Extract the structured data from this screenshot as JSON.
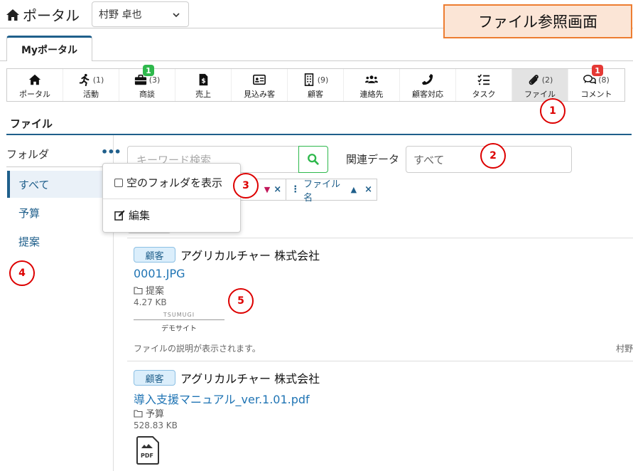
{
  "header": {
    "app_title": "ポータル",
    "user_name": "村野 卓也",
    "screen_title": "ファイル参照画面"
  },
  "tab": {
    "label": "Myポータル"
  },
  "nav": [
    {
      "label": "ポータル",
      "icon": "home-icon",
      "count": ""
    },
    {
      "label": "活動",
      "icon": "running-icon",
      "count": "(1)"
    },
    {
      "label": "商談",
      "icon": "briefcase-icon",
      "count": "(3)",
      "badge": "1"
    },
    {
      "label": "売上",
      "icon": "invoice-icon",
      "count": ""
    },
    {
      "label": "見込み客",
      "icon": "id-card-icon",
      "count": ""
    },
    {
      "label": "顧客",
      "icon": "building-icon",
      "count": "(9)"
    },
    {
      "label": "連絡先",
      "icon": "people-icon",
      "count": ""
    },
    {
      "label": "顧客対応",
      "icon": "phone-icon",
      "count": ""
    },
    {
      "label": "タスク",
      "icon": "tasklist-icon",
      "count": ""
    },
    {
      "label": "ファイル",
      "icon": "paperclip-icon",
      "count": "(2)",
      "active": true
    },
    {
      "label": "コメント",
      "icon": "comments-icon",
      "count": "(8)",
      "badge": "1"
    }
  ],
  "callouts": [
    "1",
    "2",
    "3",
    "4",
    "5"
  ],
  "section": {
    "title": "ファイル"
  },
  "folders": {
    "heading": "フォルダ",
    "more": "•••",
    "items": [
      "すべて",
      "予算",
      "提案"
    ]
  },
  "search": {
    "placeholder": "キーワード検索",
    "related_label": "関連データ",
    "related_value": "すべて"
  },
  "sort": {
    "chip1_dir": "▼",
    "chip2_label": "ファイル名",
    "chip2_dir": "▲",
    "remove": "×"
  },
  "dropdown": {
    "show_empty": "空のフォルダを表示",
    "edit": "編集"
  },
  "files": [
    {
      "tag": "顧客",
      "company": "アグリカルチャー 株式会社",
      "name": "0001.JPG",
      "folder": "提案",
      "size": "4.27 KB",
      "thumb_line1": "TSUMUGI",
      "thumb_line2": "デモサイト",
      "description": "ファイルの説明が表示されます。",
      "owner": "村野"
    },
    {
      "tag": "顧客",
      "company": "アグリカルチャー 株式会社",
      "name": "導入支援マニュアル_ver.1.01.pdf",
      "folder": "予算",
      "size": "528.83 KB",
      "pdf_label": "PDF"
    }
  ],
  "colors": {
    "accent": "#1f5f8b",
    "link": "#1f74b4",
    "green": "#2eb84c",
    "red": "#e53935",
    "callout": "#dd0000",
    "title_bg": "#fbe5d6",
    "title_border": "#ed7d31"
  }
}
